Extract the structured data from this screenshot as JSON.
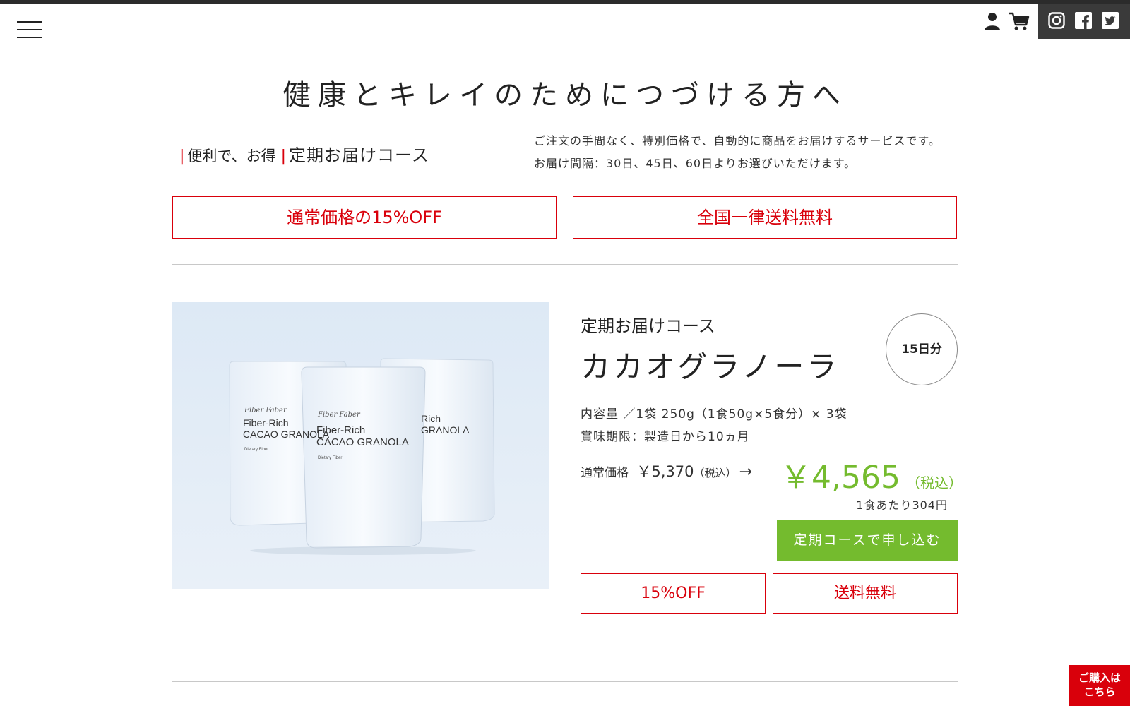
{
  "header": {
    "menu_icon": "hamburger-icon",
    "account_icon": "user-icon",
    "cart_icon": "cart-icon",
    "social_icons": [
      "instagram-icon",
      "facebook-icon",
      "twitter-icon"
    ]
  },
  "hero": {
    "title": "健康とキレイのためにつづける方へ"
  },
  "course": {
    "sub_label": "便利で、お得",
    "main_label": "定期お届けコース",
    "desc_line1": "ご注文の手間なく、特別価格で、自動的に商品をお届けするサービスです。",
    "desc_line2": "お届け間隔：30日、45日、60日よりお選びいただけます。"
  },
  "benefits": {
    "left": "通常価格の15%OFF",
    "right": "全国一律送料無料"
  },
  "product": {
    "kicker": "定期お届けコース",
    "name": "カカオグラノーラ",
    "days_badge": "15日分",
    "spec_contents": "内容量 ／1袋 250g（1食50g×5食分）× 3袋",
    "spec_expiry": "賞味期限：製造日から10ヵ月",
    "regular_label": "通常価格",
    "regular_amount": "￥5,370",
    "regular_tax": "（税込）",
    "arrow": "→",
    "sale_amount": "￥4,565",
    "sale_tax": "（税込）",
    "per_meal": "1食あたり304円",
    "subscribe_label": "定期コースで申し込む",
    "tag_left": "15%OFF",
    "tag_right": "送料無料",
    "package_brand": "Fiber Faber",
    "package_line1": "Fiber-Rich",
    "package_line2": "CACAO GRANOLA",
    "package_note": "Dietary Fiber"
  },
  "floating": {
    "purchase_line1": "ご購入は",
    "purchase_line2": "こちら"
  },
  "colors": {
    "accent_red": "#d9000b",
    "accent_green": "#74bb2e",
    "dark_bar": "#3a3a3a",
    "image_bg": "#e3edf7"
  }
}
